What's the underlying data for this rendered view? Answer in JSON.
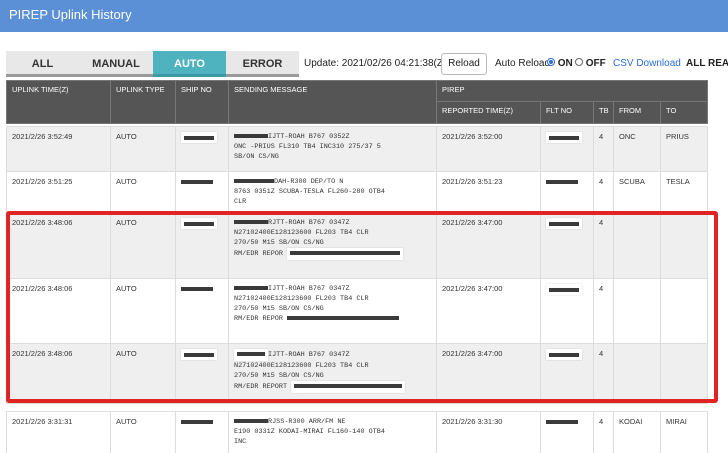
{
  "window": {
    "title": "PIREP Uplink History"
  },
  "tabs": [
    {
      "label": "ALL",
      "active": false
    },
    {
      "label": "MANUAL",
      "active": false
    },
    {
      "label": "AUTO",
      "active": true
    },
    {
      "label": "ERROR",
      "active": false
    }
  ],
  "toolbar": {
    "update_text": "Update: 2021/02/26 04:21:38(Z)",
    "reload_label": "Reload",
    "auto_reload_label": "Auto Reload",
    "on_label": "ON",
    "off_label": "OFF",
    "auto_reload_on": true,
    "csv_label": "CSV Download",
    "all_read_label": "ALL REA"
  },
  "table": {
    "headers": {
      "uplink_time": "UPLINK TIME(Z)",
      "uplink_type": "UPLINK TYPE",
      "ship_no": "SHIP NO",
      "sending_message": "SENDING MESSAGE",
      "pirep": "PIREP",
      "reported_time": "REPORTED TIME(Z)",
      "flt_no": "FLT NO",
      "tb": "TB",
      "from": "FROM",
      "to": "TO"
    },
    "rows": [
      {
        "uplink_time": "2021/2/26 3:52:49",
        "uplink_type": "AUTO",
        "msg_lines": [
          "IJTT-ROAH B767 0352Z",
          "ONC -PRIUS FL310 TB4 INC310 275/37 5",
          "SB/ON CS/NG"
        ],
        "reported_time": "2021/2/26 3:52:00",
        "tb": "4",
        "from": "ONC",
        "to": "PRIUS"
      },
      {
        "uplink_time": "2021/2/26 3:51:25",
        "uplink_type": "AUTO",
        "msg_lines": [
          "DAH-R300 DEP/TO N",
          "8763 0351Z SCUBA-TESLA FL260-280 OTB4",
          "CLR"
        ],
        "reported_time": "2021/2/26 3:51:23",
        "tb": "4",
        "from": "SCUBA",
        "to": "TESLA"
      },
      {
        "uplink_time": "2021/2/26 3:48:06",
        "uplink_type": "AUTO",
        "msg_lines": [
          "RJTT-ROAH B767 0347Z",
          "N27102400E128123600 FL203 TB4 CLR",
          "270/50 M15 SB/ON CS/NG",
          "RM/EDR REPOR"
        ],
        "reported_time": "2021/2/26 3:47:00",
        "tb": "4",
        "from": "",
        "to": ""
      },
      {
        "uplink_time": "2021/2/26 3:48:06",
        "uplink_type": "AUTO",
        "msg_lines": [
          "IJTT-ROAH B767 0347Z",
          "N27102400E128123600 FL203 TB4 CLR",
          "270/50 M15 SB/ON CS/NG",
          "RM/EDR REPOR"
        ],
        "reported_time": "2021/2/26 3:47:00",
        "tb": "4",
        "from": "",
        "to": ""
      },
      {
        "uplink_time": "2021/2/26 3:48:06",
        "uplink_type": "AUTO",
        "msg_lines": [
          "IJTT-ROAH B767 0347Z",
          "N27102400E128123600 FL203 TB4 CLR",
          "270/50 M15 SB/ON CS/NG",
          "RM/EDR REPORT"
        ],
        "reported_time": "2021/2/26 3:47:00",
        "tb": "4",
        "from": "",
        "to": ""
      },
      {
        "uplink_time": "2021/2/26 3:31:31",
        "uplink_type": "AUTO",
        "msg_lines": [
          "RJSS-R300 ARR/FM NE",
          "E190 0331Z KODAI-MIRAI FL160-140 OTB4",
          "INC"
        ],
        "reported_time": "2021/2/26 3:31:30",
        "tb": "4",
        "from": "KODAI",
        "to": "MIRAI"
      }
    ]
  }
}
